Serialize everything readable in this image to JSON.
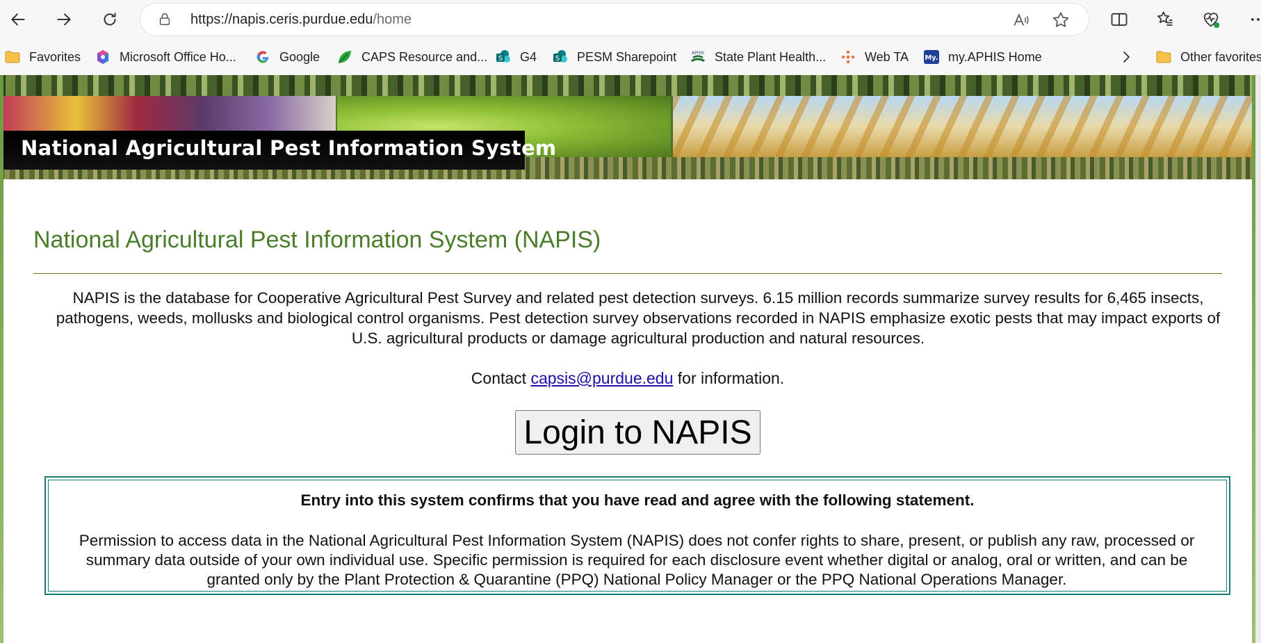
{
  "browser": {
    "url_host": "https://napis.ceris.purdue.edu",
    "url_path": "/home",
    "icons": [
      "back-icon",
      "forward-icon",
      "refresh-icon",
      "lock-icon",
      "read-aloud-icon",
      "favorite-star-icon",
      "split-screen-icon",
      "favorites-icon",
      "browser-essentials-icon",
      "more-icon"
    ]
  },
  "bookmarks": [
    {
      "label": "Favorites",
      "icon": "folder-icon"
    },
    {
      "label": "Microsoft Office Ho...",
      "icon": "office-icon"
    },
    {
      "label": "Google",
      "icon": "google-icon"
    },
    {
      "label": "CAPS Resource and...",
      "icon": "leaf-icon"
    },
    {
      "label": "G4",
      "icon": "sharepoint-icon"
    },
    {
      "label": "PESM Sharepoint",
      "icon": "sharepoint-icon"
    },
    {
      "label": "State Plant Health...",
      "icon": "aphis-icon"
    },
    {
      "label": "Web TA",
      "icon": "webta-icon"
    },
    {
      "label": "my.APHIS  Home",
      "icon": "myaphis-icon"
    },
    {
      "label": "Other favorites",
      "icon": "folder-icon"
    }
  ],
  "banner": {
    "title": "National Agricultural Pest Information System"
  },
  "main": {
    "heading": "National Agricultural Pest Information System (NAPIS)",
    "intro": "NAPIS is the database for Cooperative Agricultural Pest Survey and related pest detection surveys. 6.15 million records summarize survey results for 6,465 insects, pathogens, weeds, mollusks and biological control organisms. Pest detection survey observations recorded in NAPIS emphasize exotic pests that may impact exports of U.S. agricultural products or damage agricultural production and natural resources.",
    "contact_prefix": "Contact",
    "contact_email": "capsis@purdue.edu",
    "contact_suffix": "for information.",
    "login_label": "Login to NAPIS",
    "notice_heading": "Entry into this system confirms that you have read and agree with the following statement.",
    "notice_body": "Permission to access data in the National Agricultural Pest Information System (NAPIS) does not confer rights to share, present, or publish any raw, processed or summary data outside of your own individual use. Specific permission is required for each disclosure event whether digital or analog, oral or written, and can be granted only by the Plant Protection & Quarantine (PPQ) National Policy Manager or the PPQ National Operations Manager."
  }
}
